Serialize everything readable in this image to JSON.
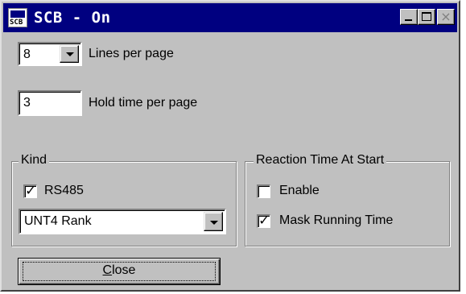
{
  "window": {
    "title": "SCB - On",
    "icon_text": "SCB",
    "controls": {
      "minimize_icon": "minimize-icon",
      "maximize_icon": "maximize-icon",
      "close_icon": "close-icon",
      "close_glyph": "×"
    }
  },
  "lines_per_page": {
    "value": "8",
    "label": "Lines per page"
  },
  "hold_time": {
    "value": "3",
    "label": "Hold time per page"
  },
  "kind": {
    "title": "Kind",
    "rs485": {
      "label": "RS485",
      "checked": true,
      "mark": "✓"
    },
    "protocol": {
      "value": "UNT4 Rank"
    }
  },
  "reaction": {
    "title": "Reaction Time At Start",
    "enable": {
      "label": "Enable",
      "checked": false,
      "mark": ""
    },
    "mask_running_time": {
      "label": "Mask Running Time",
      "checked": true,
      "mark": "✓"
    }
  },
  "close_button": {
    "mnemonic": "C",
    "rest": "lose"
  },
  "colors": {
    "face": "#c0c0c0",
    "title_bar": "#000080",
    "title_text": "#ffffff"
  }
}
